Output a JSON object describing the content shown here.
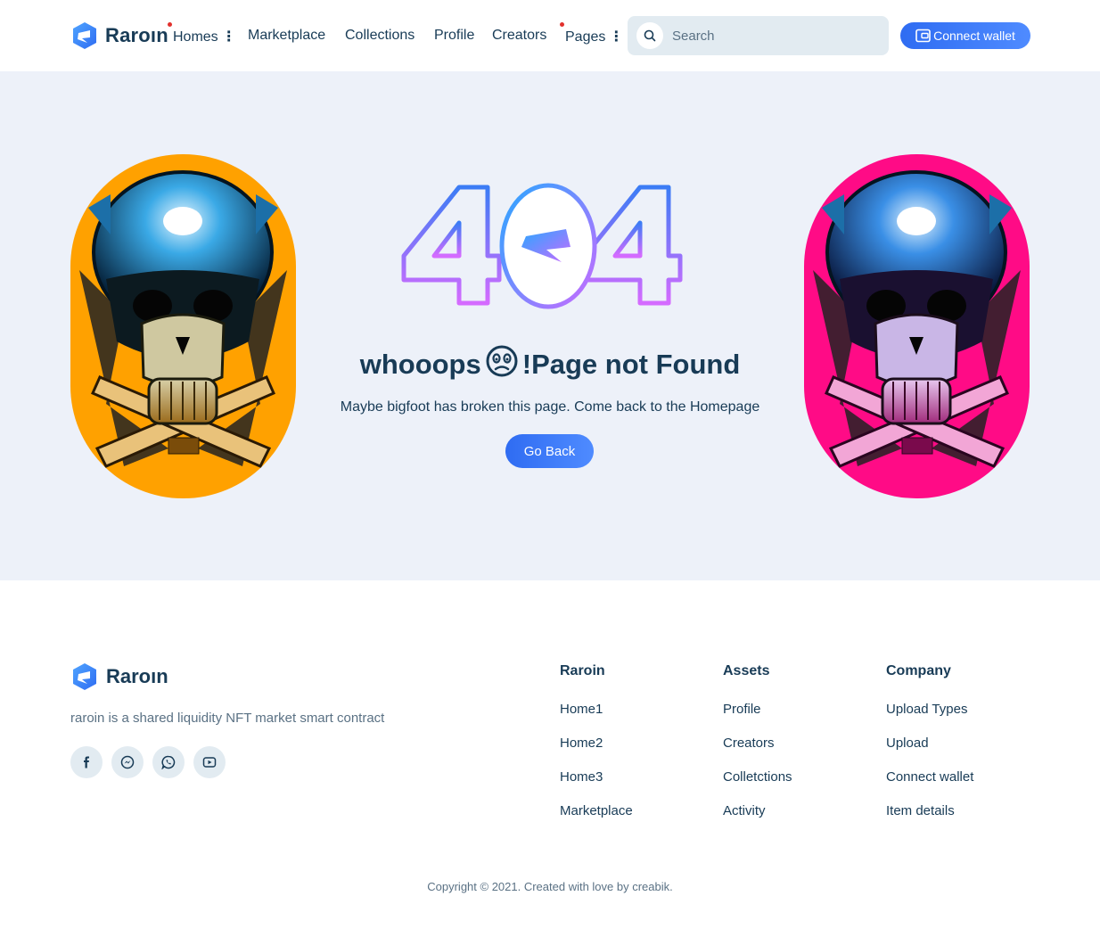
{
  "brand": {
    "name": "Raroın"
  },
  "nav": {
    "items": [
      {
        "label": "Homes",
        "has_dot": true,
        "has_menu": true
      },
      {
        "label": "Marketplace"
      },
      {
        "label": "Collections"
      },
      {
        "label": "Profile"
      },
      {
        "label": "Creators"
      },
      {
        "label": "Pages",
        "has_dot": true,
        "has_menu": true
      }
    ]
  },
  "search": {
    "placeholder": "Search"
  },
  "wallet_button": {
    "label": "Connect wallet"
  },
  "hero": {
    "code": "404",
    "title_before": "whooops",
    "title_after": "!Page not Found",
    "subtitle": "Maybe bigfoot has broken this page. Come back to the Homepage",
    "button": "Go Back"
  },
  "footer": {
    "brand": "Raroın",
    "description": "raroin is a shared liquidity NFT market smart contract",
    "socials": [
      "facebook-icon",
      "messenger-icon",
      "whatsapp-icon",
      "youtube-icon"
    ],
    "columns": [
      {
        "title": "Raroin",
        "links": [
          "Home1",
          "Home2",
          "Home3",
          "Marketplace"
        ]
      },
      {
        "title": "Assets",
        "links": [
          "Profile",
          "Creators",
          "Colletctions",
          "Activity"
        ]
      },
      {
        "title": "Company",
        "links": [
          "Upload Types",
          "Upload",
          "Connect wallet",
          "Item details"
        ]
      }
    ],
    "copyright": "Copyright © 2021. Created with love by creabik."
  },
  "colors": {
    "accent": "#2f6cf2",
    "text": "#183b56",
    "hero_bg": "#edf1f9",
    "orange": "#ffa100",
    "pink": "#ff0b86"
  }
}
